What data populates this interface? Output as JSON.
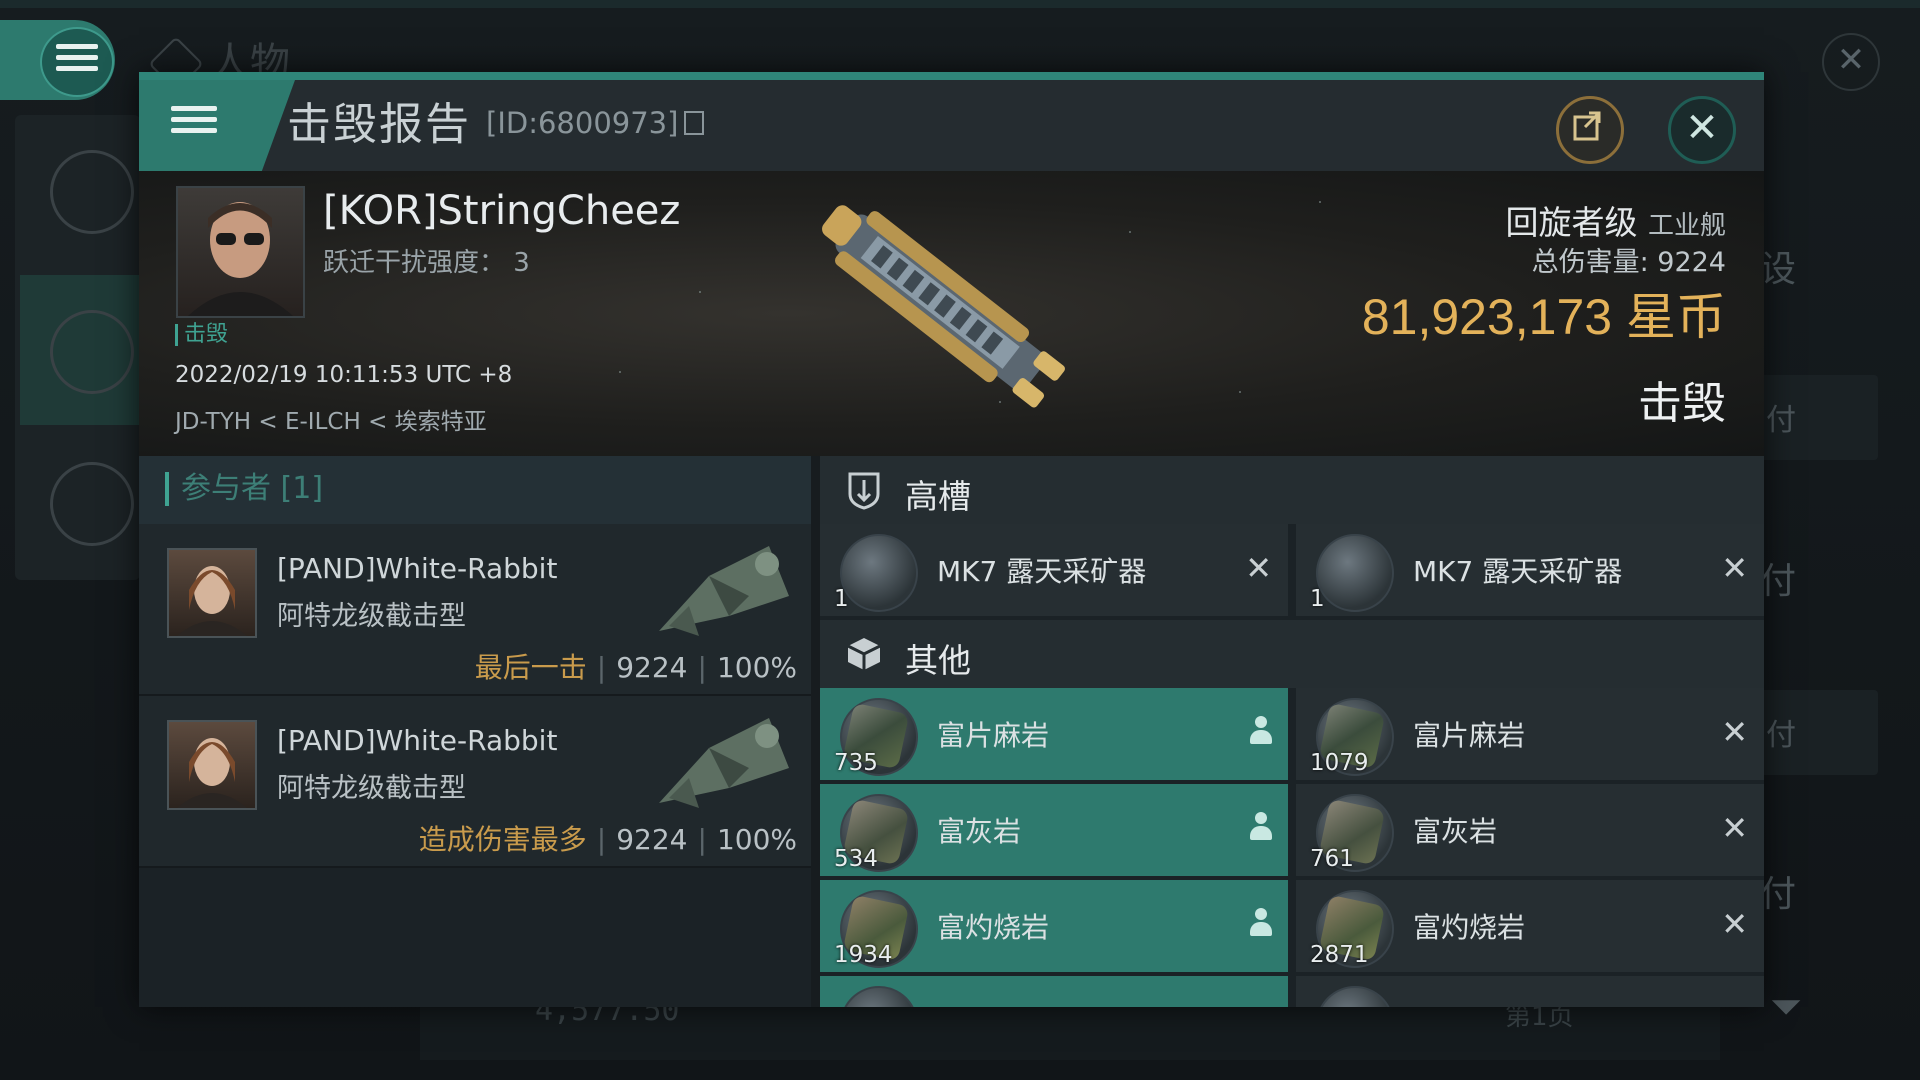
{
  "background": {
    "title": "人物",
    "right_labels": [
      "设",
      "付",
      "付",
      "付",
      "付"
    ],
    "bottom_number": "4,577.50",
    "bottom_page": "第1页"
  },
  "modal": {
    "title": "击毁报告",
    "report_id": "[ID:6800973]",
    "victim": {
      "name": "[KOR]StringCheez",
      "warp_disruption": "跃迁干扰强度：  3",
      "tag": "击毁",
      "timestamp": "2022/02/19 10:11:53 UTC +8",
      "location": "JD-TYH < E-ILCH < 埃索特亚",
      "ship_class": "回旋者级",
      "ship_type": "工业舰",
      "total_damage": "总伤害量: 9224",
      "isk_value": "81,923,173  星币",
      "status": "击毁"
    },
    "participants": {
      "header": "参与者 [1]",
      "rows": [
        {
          "name": "[PAND]White-Rabbit",
          "ship": "阿特龙级截击型",
          "label": "最后一击",
          "damage": "9224",
          "percent": "100%"
        },
        {
          "name": "[PAND]White-Rabbit",
          "ship": "阿特龙级截击型",
          "label": "造成伤害最多",
          "damage": "9224",
          "percent": "100%"
        }
      ]
    },
    "high_slots": {
      "title": "高槽",
      "items": [
        {
          "qty": "1",
          "name": "MK7 露天采矿器",
          "mark": "✕"
        },
        {
          "qty": "1",
          "name": "MK7 露天采矿器",
          "mark": "✕"
        }
      ]
    },
    "other": {
      "title": "其他",
      "items": [
        {
          "qty": "735",
          "name": "富片麻岩",
          "dropped": true
        },
        {
          "qty": "1079",
          "name": "富片麻岩",
          "mark": "✕"
        },
        {
          "qty": "534",
          "name": "富灰岩",
          "dropped": true
        },
        {
          "qty": "761",
          "name": "富灰岩",
          "mark": "✕"
        },
        {
          "qty": "1934",
          "name": "富灼烧岩",
          "dropped": true
        },
        {
          "qty": "2871",
          "name": "富灼烧岩",
          "mark": "✕"
        }
      ]
    }
  },
  "icons": {
    "menu": "hamburger-icon",
    "share": "share-icon",
    "close": "close-icon",
    "copy": "copy-icon",
    "dropped": "person-icon",
    "destroyed": "x-icon",
    "high_slot": "shield-slot-icon",
    "other": "cube-icon"
  },
  "colors": {
    "accent": "#2d7a6e",
    "isk": "#e3b25a",
    "participant_label": "#c99b4c"
  }
}
